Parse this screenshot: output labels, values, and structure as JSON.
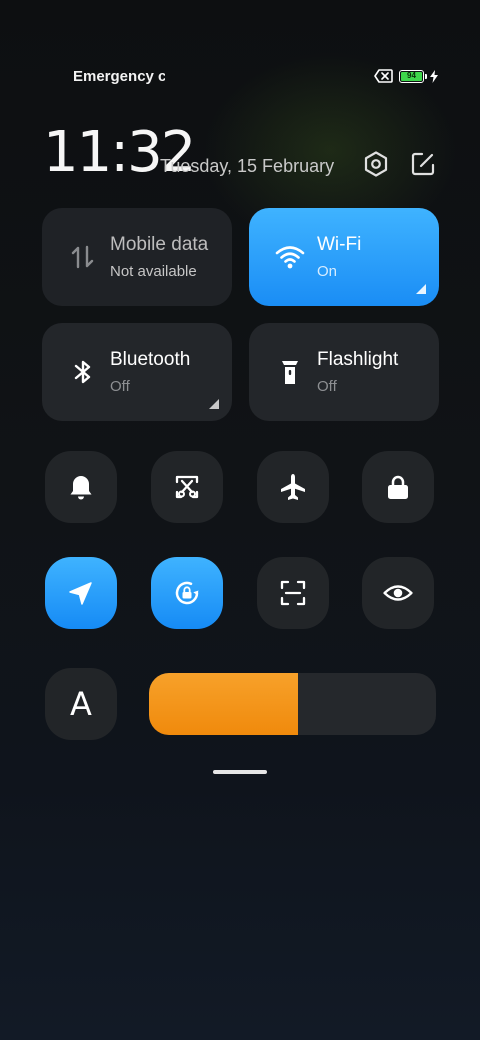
{
  "status_bar": {
    "carrier_text": "Emergency calls only",
    "battery_level": "94",
    "battery_color": "#3ed64b",
    "icons": [
      "no-sim-icon",
      "battery-icon",
      "charging-bolt-icon"
    ]
  },
  "header": {
    "time": "11:32",
    "date": "Tuesday, 15 February",
    "icons": [
      "settings-icon",
      "edit-icon"
    ]
  },
  "tiles": [
    {
      "title": "Mobile data",
      "status": "Not available",
      "icon": "mobile-data-icon",
      "active": false
    },
    {
      "title": "Wi-Fi",
      "status": "On",
      "icon": "wifi-icon",
      "active": true
    },
    {
      "title": "Bluetooth",
      "status": "Off",
      "icon": "bluetooth-icon",
      "active": false
    },
    {
      "title": "Flashlight",
      "status": "Off",
      "icon": "flashlight-icon",
      "active": false
    }
  ],
  "toggles_row1": [
    {
      "icon": "bell-icon",
      "active": false
    },
    {
      "icon": "screenshot-icon",
      "active": false
    },
    {
      "icon": "airplane-icon",
      "active": false
    },
    {
      "icon": "lock-icon",
      "active": false
    }
  ],
  "toggles_row2": [
    {
      "icon": "location-icon",
      "active": true
    },
    {
      "icon": "rotation-lock-icon",
      "active": true
    },
    {
      "icon": "scan-icon",
      "active": false
    },
    {
      "icon": "eye-icon",
      "active": false
    }
  ],
  "brightness": {
    "auto_label": "A",
    "level_fraction": 0.52,
    "accent_color": "#f39418"
  },
  "colors": {
    "active_blue": "#2a9ff8",
    "tile_bg": "#23262a"
  }
}
